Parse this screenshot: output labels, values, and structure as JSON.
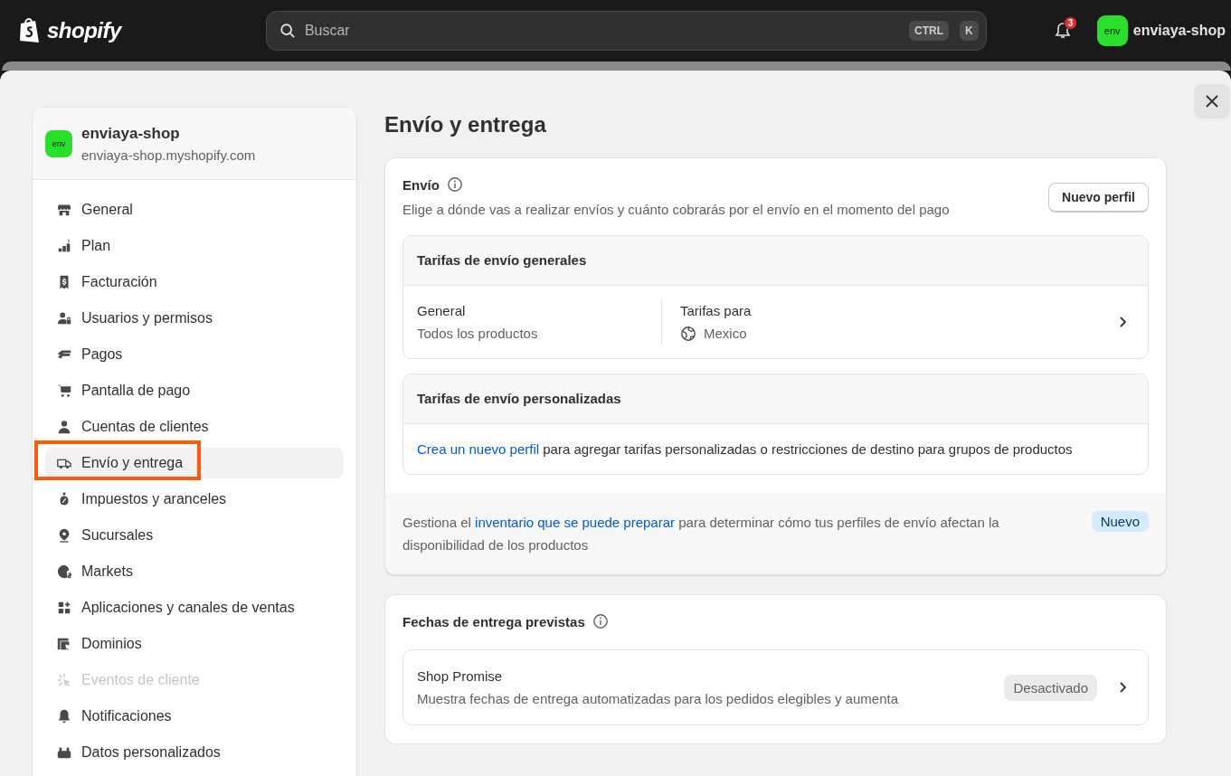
{
  "topbar": {
    "logo": "shopify",
    "search": {
      "placeholder": "Buscar",
      "keys": [
        "CTRL",
        "K"
      ]
    },
    "notifications": {
      "count": "3"
    },
    "store": {
      "avatar": "env",
      "name": "enviaya-shop"
    }
  },
  "sidebar": {
    "store": {
      "avatar": "env",
      "name": "enviaya-shop",
      "domain": "enviaya-shop.myshopify.com"
    },
    "items": [
      {
        "label": "General",
        "selected": false,
        "disabled": false,
        "highlighted": false
      },
      {
        "label": "Plan",
        "selected": false,
        "disabled": false,
        "highlighted": false
      },
      {
        "label": "Facturación",
        "selected": false,
        "disabled": false,
        "highlighted": false
      },
      {
        "label": "Usuarios y permisos",
        "selected": false,
        "disabled": false,
        "highlighted": false
      },
      {
        "label": "Pagos",
        "selected": false,
        "disabled": false,
        "highlighted": false
      },
      {
        "label": "Pantalla de pago",
        "selected": false,
        "disabled": false,
        "highlighted": false
      },
      {
        "label": "Cuentas de clientes",
        "selected": false,
        "disabled": false,
        "highlighted": false
      },
      {
        "label": "Envío y entrega",
        "selected": true,
        "disabled": false,
        "highlighted": true
      },
      {
        "label": "Impuestos y aranceles",
        "selected": false,
        "disabled": false,
        "highlighted": false
      },
      {
        "label": "Sucursales",
        "selected": false,
        "disabled": false,
        "highlighted": false
      },
      {
        "label": "Markets",
        "selected": false,
        "disabled": false,
        "highlighted": false
      },
      {
        "label": "Aplicaciones y canales de ventas",
        "selected": false,
        "disabled": false,
        "highlighted": false
      },
      {
        "label": "Dominios",
        "selected": false,
        "disabled": false,
        "highlighted": false
      },
      {
        "label": "Eventos de cliente",
        "selected": false,
        "disabled": true,
        "highlighted": false
      },
      {
        "label": "Notificaciones",
        "selected": false,
        "disabled": false,
        "highlighted": false
      },
      {
        "label": "Datos personalizados",
        "selected": false,
        "disabled": false,
        "highlighted": false
      }
    ]
  },
  "page": {
    "title": "Envío y entrega"
  },
  "shipping": {
    "title": "Envío",
    "description": "Elige a dónde vas a realizar envíos y cuánto cobrarás por el envío en el momento del pago",
    "button": "Nuevo perfil",
    "general_rates": {
      "title": "Tarifas de envío generales",
      "profile": "General",
      "products": "Todos los productos",
      "rates_label": "Tarifas para",
      "region": "Mexico"
    },
    "custom_rates": {
      "title": "Tarifas de envío personalizadas",
      "link": "Crea un nuevo perfil",
      "after": " para agregar tarifas personalizadas o restricciones de destino para grupos de productos"
    },
    "footer": {
      "before": "Gestiona el ",
      "link": "inventario que se puede preparar",
      "after": " para determinar cómo tus perfiles de envío afectan la disponibilidad de los productos",
      "badge": "Nuevo"
    }
  },
  "delivery_dates": {
    "title": "Fechas de entrega previstas",
    "items": [
      {
        "title": "Shop Promise",
        "description": "Muestra fechas de entrega automatizadas para los pedidos elegibles y aumenta",
        "status": "Desactivado"
      }
    ]
  }
}
